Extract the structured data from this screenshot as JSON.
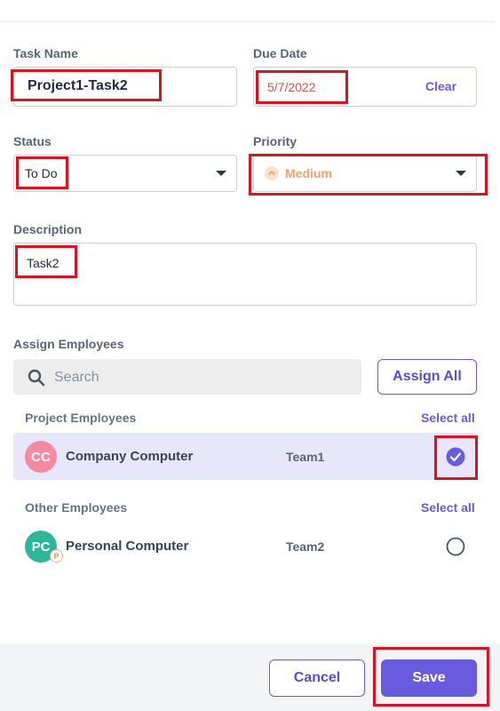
{
  "form": {
    "task_name_label": "Task Name",
    "task_name_value": "Project1-Task2",
    "due_date_label": "Due Date",
    "due_date_value": "5/7/2022",
    "clear_label": "Clear",
    "status_label": "Status",
    "status_value": "To Do",
    "priority_label": "Priority",
    "priority_value": "Medium",
    "description_label": "Description",
    "description_value": "Task2"
  },
  "assign": {
    "label": "Assign Employees",
    "search_placeholder": "Search",
    "assign_all_label": "Assign All"
  },
  "project_employees": {
    "title": "Project Employees",
    "select_all": "Select all",
    "items": [
      {
        "initials": "CC",
        "name": "Company Computer",
        "team": "Team1",
        "checked": true
      }
    ]
  },
  "other_employees": {
    "title": "Other Employees",
    "select_all": "Select all",
    "items": [
      {
        "initials": "PC",
        "badge": "P",
        "name": "Personal Computer",
        "team": "Team2",
        "checked": false
      }
    ]
  },
  "footer": {
    "cancel_label": "Cancel",
    "save_label": "Save"
  },
  "colors": {
    "accent": "#6a5ae0",
    "highlight_red": "#e0101e",
    "priority_orange": "#f0a06a",
    "due_date_red": "#d9534f",
    "cc_avatar": "#f58aa0",
    "pc_avatar": "#2bb89a"
  }
}
